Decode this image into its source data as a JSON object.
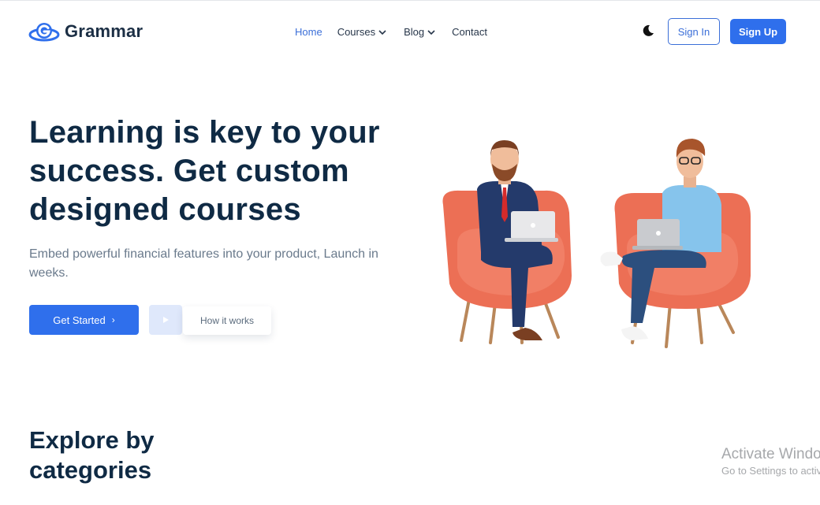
{
  "brand": {
    "name": "Grammar",
    "logo_icon": "g-orbit-logo-icon"
  },
  "nav": {
    "home": "Home",
    "courses": "Courses",
    "blog": "Blog",
    "contact": "Contact"
  },
  "header": {
    "theme_icon": "moon-icon",
    "sign_in": "Sign In",
    "sign_up": "Sign Up"
  },
  "hero": {
    "title": "Learning is key to your success. Get custom designed courses",
    "subtitle": "Embed powerful financial features into your product, Launch in weeks.",
    "get_started": "Get Started",
    "get_started_arrow": "›",
    "how_it_works": "How it works",
    "illustration": "two-people-on-chairs-with-laptops"
  },
  "categories": {
    "title": "Explore by categories"
  },
  "windows_watermark": {
    "title": "Activate Windows",
    "subtitle": "Go to Settings to activate Windows."
  },
  "colors": {
    "primary": "#2f6fec",
    "heading": "#0f2a44",
    "muted": "#6a7a8c",
    "chair": "#ec6f55"
  }
}
